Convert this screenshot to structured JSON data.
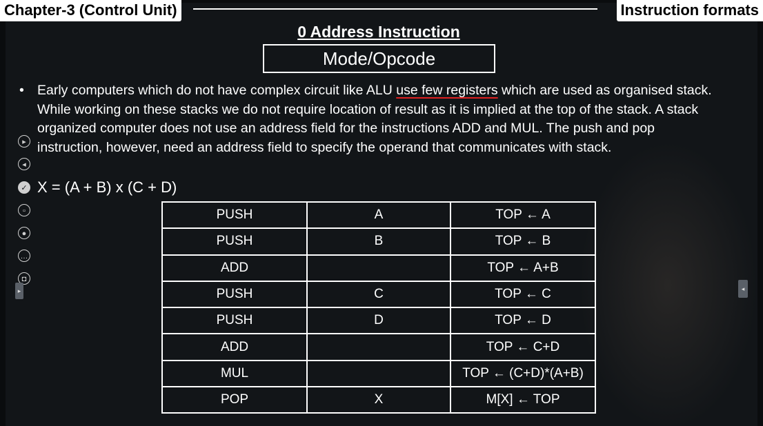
{
  "header": {
    "chapter": "Chapter-3 (Control Unit)",
    "topic": "Instruction formats"
  },
  "section_title": "0 Address Instruction",
  "format_box": "Mode/Opcode",
  "bullet": {
    "marker": "•",
    "text_part1": "Early computers which do not have complex circuit like ALU ",
    "text_underlined": "use few registers",
    "text_part2": " which are used as organised stack. While working on these stacks we do not require location of result as it is implied at the top of the stack. A stack organized computer does not use an address field for the instructions ADD and MUL.  The push and pop instruction, however, need an address field to specify the operand that communicates with stack."
  },
  "formula": "X = (A + B) x (C + D)",
  "toolbar": {
    "icons": [
      "play-icon",
      "rewind-icon",
      "check-icon",
      "copy-icon",
      "camera-icon",
      "more-icon",
      "chat-icon"
    ]
  },
  "table": {
    "rows": [
      {
        "op": "PUSH",
        "operand": "A",
        "action": "TOP ← A"
      },
      {
        "op": "PUSH",
        "operand": "B",
        "action": "TOP ← B"
      },
      {
        "op": "ADD",
        "operand": "",
        "action": "TOP ← A+B"
      },
      {
        "op": "PUSH",
        "operand": "C",
        "action": "TOP ← C"
      },
      {
        "op": "PUSH",
        "operand": "D",
        "action": "TOP ← D"
      },
      {
        "op": "ADD",
        "operand": "",
        "action": "TOP ← C+D"
      },
      {
        "op": "MUL",
        "operand": "",
        "action": "TOP ← (C+D)*(A+B)"
      },
      {
        "op": "POP",
        "operand": "X",
        "action": "M[X] ← TOP"
      }
    ]
  },
  "colors": {
    "background": "#121518",
    "text": "#ffffff",
    "underline_accent": "#e02020"
  }
}
